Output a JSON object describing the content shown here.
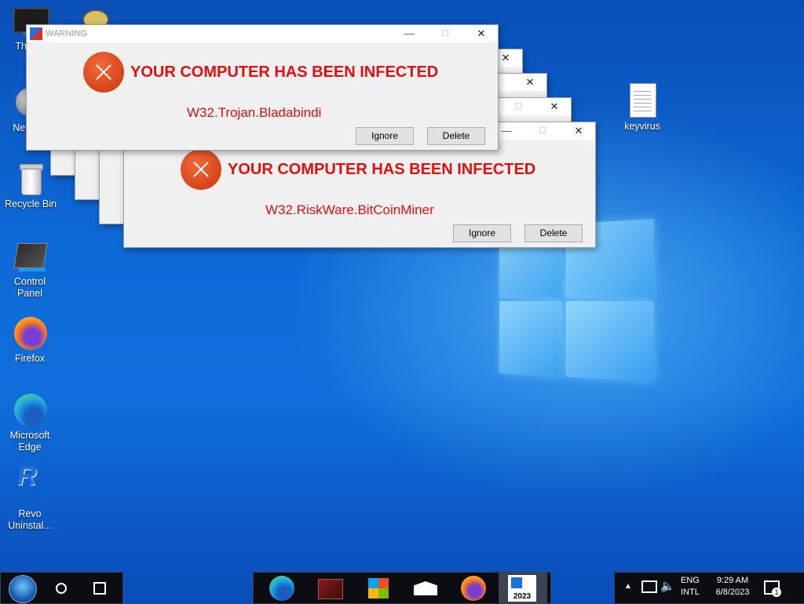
{
  "desktop": {
    "icons": [
      {
        "label": "Thi",
        "name": "this-pc"
      },
      {
        "label": "Net",
        "name": "network"
      },
      {
        "label": "Recycle Bin",
        "name": "recycle-bin"
      },
      {
        "label": "Control Panel",
        "name": "control-panel"
      },
      {
        "label": "Firefox",
        "name": "firefox"
      },
      {
        "label": "Microsoft Edge",
        "name": "microsoft-edge"
      },
      {
        "label": "Revo Uninstal...",
        "name": "revo-uninstaller"
      },
      {
        "label": "keyvirus",
        "name": "keyvirus-file"
      }
    ]
  },
  "dialog_front": {
    "title": "WARNING",
    "headline": "YOUR COMPUTER HAS BEEN INFECTED",
    "virus": "W32.Trojan.Bladabindi",
    "ignore": "Ignore",
    "delete": "Delete"
  },
  "dialog_second": {
    "headline": "YOUR COMPUTER HAS BEEN INFECTED",
    "virus": "W32.RiskWare.BitCoinMiner",
    "ignore": "Ignore",
    "delete": "Delete"
  },
  "window_controls": {
    "minimize": "—",
    "maximize": "☐",
    "close": "✕"
  },
  "taskbar": {
    "apps": [
      "edge-icon",
      "winrar-icon",
      "store-icon",
      "mail-icon",
      "firefox-icon",
      "app-2023-icon"
    ],
    "app_2023_label": "2023",
    "language": "ENG",
    "layout": "INTL",
    "time": "9:29 AM",
    "date": "6/8/2023",
    "notification_count": "1"
  }
}
